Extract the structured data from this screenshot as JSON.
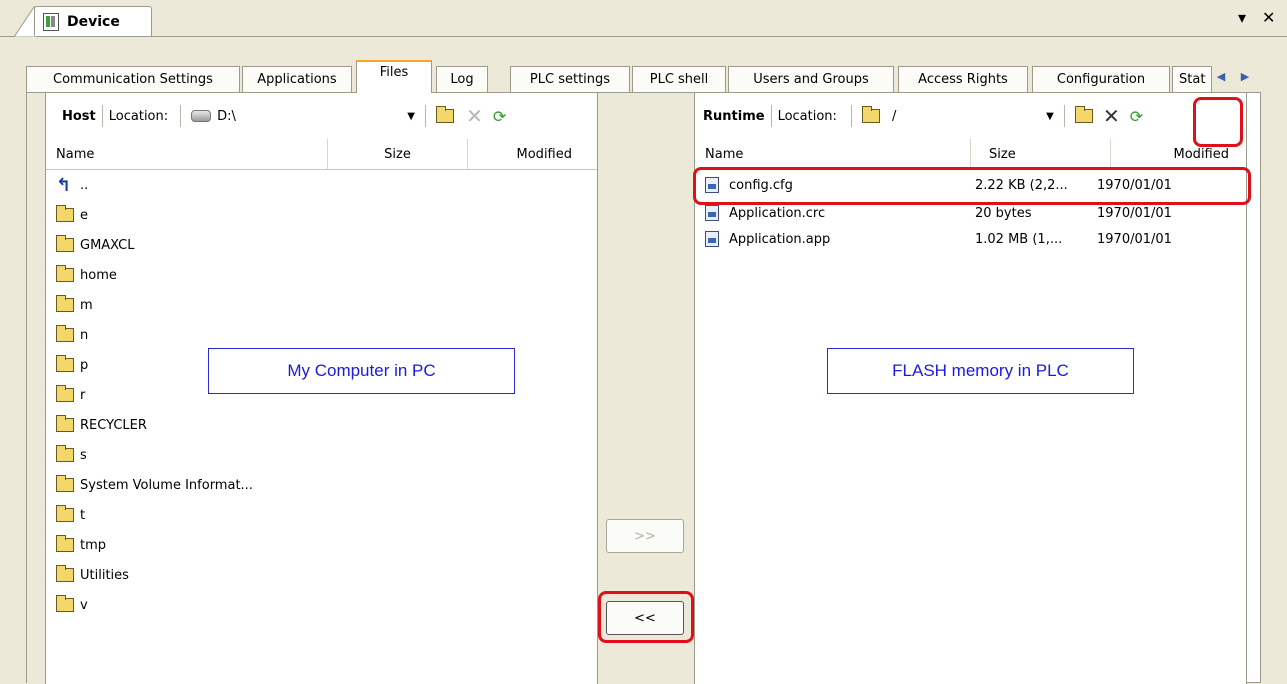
{
  "document": {
    "title": "Device",
    "menu_icon": "chevron-down-icon",
    "close_icon": "close-icon"
  },
  "tabs": [
    {
      "label": "Communication Settings"
    },
    {
      "label": "Applications"
    },
    {
      "label": "Files",
      "active": true
    },
    {
      "label": "Log"
    },
    {
      "label": "PLC settings"
    },
    {
      "label": "PLC shell"
    },
    {
      "label": "Users and Groups"
    },
    {
      "label": "Access Rights"
    },
    {
      "label": "Configuration"
    },
    {
      "label": "Stat"
    }
  ],
  "host": {
    "title": "Host",
    "location_label": "Location:",
    "location_value": "D:\\",
    "columns": [
      "Name",
      "Size",
      "Modified"
    ],
    "items": [
      "..",
      "e",
      "GMAXCL",
      "home",
      "m",
      "n",
      "p",
      "r",
      "RECYCLER",
      "s",
      "System Volume Informat...",
      "t",
      "tmp",
      "Utilities",
      "v"
    ],
    "callout": "My Computer in PC"
  },
  "runtime": {
    "title": "Runtime",
    "location_label": "Location:",
    "location_value": "/",
    "columns": [
      "Name",
      "Size",
      "Modified"
    ],
    "files": [
      {
        "name": "config.cfg",
        "size": "2.22 KB (2,2...",
        "modified": "1970/01/01"
      },
      {
        "name": "Application.crc",
        "size": "20 bytes",
        "modified": "1970/01/01"
      },
      {
        "name": "Application.app",
        "size": "1.02 MB (1,...",
        "modified": "1970/01/01"
      }
    ],
    "callout": "FLASH memory in PLC"
  },
  "transfer": {
    "to_runtime": ">>",
    "to_host": "<<"
  },
  "colors": {
    "highlight": "#e0101a",
    "callout_border": "#2b2bd8",
    "active_tab": "#f5a623"
  }
}
